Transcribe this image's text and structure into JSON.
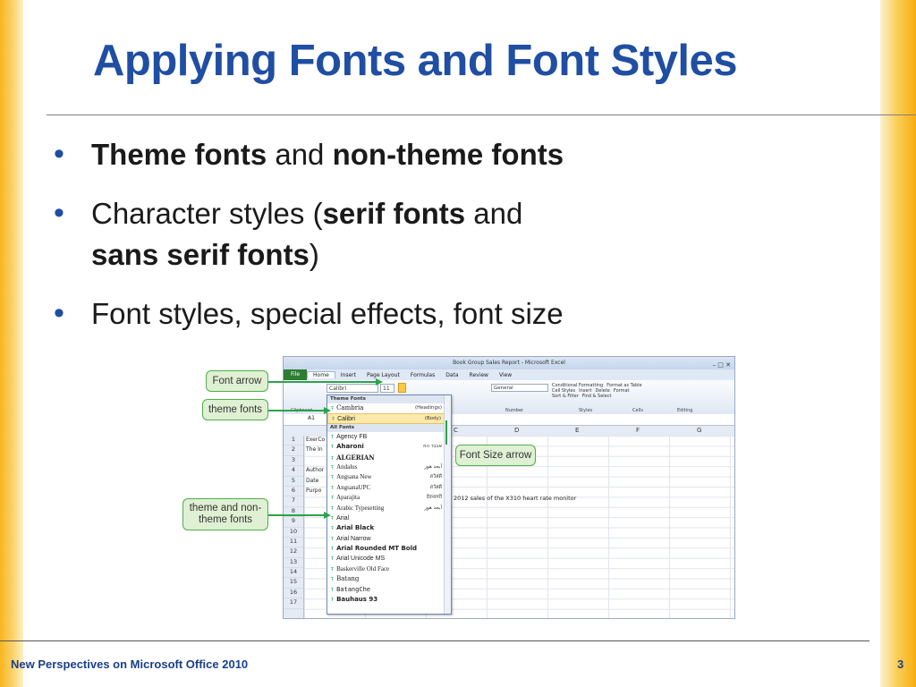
{
  "slide": {
    "title": "Applying Fonts and Font Styles",
    "footer": "New Perspectives on Microsoft Office 2010",
    "page_number": "3"
  },
  "bullets": [
    {
      "parts": [
        {
          "text": "Theme fonts",
          "bold": true
        },
        {
          "text": " and ",
          "bold": false
        },
        {
          "text": "non-theme fonts",
          "bold": true
        }
      ]
    },
    {
      "parts": [
        {
          "text": "Character styles (",
          "bold": false
        },
        {
          "text": "serif fonts",
          "bold": true
        },
        {
          "text": " and ",
          "bold": false
        },
        {
          "text": "sans serif fonts",
          "bold": true
        },
        {
          "text": ")",
          "bold": false
        }
      ]
    },
    {
      "parts": [
        {
          "text": "Font styles, special effects, font size",
          "bold": false
        }
      ]
    }
  ],
  "callouts": {
    "font_arrow": "Font arrow",
    "theme_fonts": "theme fonts",
    "theme_nontheme": "theme and non-theme fonts",
    "font_size_arrow": "Font Size arrow"
  },
  "excel": {
    "window_title": "Book Group Sales Report - Microsoft Excel",
    "tabs": [
      "File",
      "Home",
      "Insert",
      "Page Layout",
      "Formulas",
      "Data",
      "Review",
      "View"
    ],
    "active_tab": "Home",
    "name_box": "A1",
    "font_box": "Calibri",
    "size_box": "11",
    "number_format": "General",
    "ribbon_groups": [
      "Clipboard",
      "Number",
      "Styles",
      "Cells",
      "Editing"
    ],
    "ribbon_buttons": [
      "Conditional Formatting",
      "Format as Table",
      "Cell Styles",
      "Insert",
      "Delete",
      "Format",
      "Sort & Filter",
      "Find & Select"
    ],
    "columns": [
      "C",
      "D",
      "E",
      "F",
      "G"
    ],
    "rows": [
      "1",
      "2",
      "3",
      "4",
      "5",
      "6",
      "7",
      "8",
      "9",
      "10",
      "11",
      "12",
      "13",
      "14",
      "15",
      "16",
      "17"
    ],
    "column_a_cells": [
      {
        "row": 1,
        "text": "ExerCo"
      },
      {
        "row": 2,
        "text": "The In"
      },
      {
        "row": 4,
        "text": "Author"
      },
      {
        "row": 5,
        "text": "Date"
      },
      {
        "row": 6,
        "text": "Purpo"
      }
    ],
    "sales_note": "2012 sales of the X310 heart rate monitor",
    "font_list": {
      "theme_header": "Theme Fonts",
      "all_header": "All Fonts",
      "theme_fonts": [
        {
          "name": "Cambria",
          "tag": "(Headings)",
          "font": "DejaVu Serif"
        },
        {
          "name": "Calibri",
          "tag": "(Body)",
          "font": "Liberation Sans",
          "selected": true
        }
      ],
      "all_fonts": [
        {
          "name": "Agency FB",
          "tag": "",
          "font": "Liberation Sans"
        },
        {
          "name": "Aharoni",
          "tag": "אבגד הוז",
          "font": "DejaVu Sans",
          "bold": true
        },
        {
          "name": "ALGERIAN",
          "tag": "",
          "font": "DejaVu Serif",
          "bold": true
        },
        {
          "name": "Andalus",
          "tag": "أبجد هوز",
          "font": "Liberation Serif"
        },
        {
          "name": "Angsana New",
          "tag": "สวัสดี",
          "font": "Liberation Serif"
        },
        {
          "name": "AngsanaUPC",
          "tag": "สวัสดี",
          "font": "Liberation Serif"
        },
        {
          "name": "Aparajita",
          "tag": "देवनागरी",
          "font": "Liberation Serif"
        },
        {
          "name": "Arabic Typesetting",
          "tag": "أبجد هوز",
          "font": "Liberation Serif"
        },
        {
          "name": "Arial",
          "tag": "",
          "font": "Liberation Sans"
        },
        {
          "name": "Arial Black",
          "tag": "",
          "font": "DejaVu Sans",
          "bold": true
        },
        {
          "name": "Arial Narrow",
          "tag": "",
          "font": "Liberation Sans"
        },
        {
          "name": "Arial Rounded MT Bold",
          "tag": "",
          "font": "DejaVu Sans",
          "bold": true
        },
        {
          "name": "Arial Unicode MS",
          "tag": "",
          "font": "Liberation Sans"
        },
        {
          "name": "Baskerville Old Face",
          "tag": "",
          "font": "Liberation Serif"
        },
        {
          "name": "Batang",
          "tag": "",
          "font": "DejaVu Serif"
        },
        {
          "name": "BatangChe",
          "tag": "",
          "font": "DejaVu Sans Mono"
        },
        {
          "name": "Bauhaus 93",
          "tag": "",
          "font": "DejaVu Sans",
          "bold": true
        }
      ]
    }
  },
  "colors": {
    "title": "#1f4ea3",
    "bullet": "#1f4ea3",
    "callout_fill": "#dff0d3",
    "callout_border": "#4fae4b",
    "arrow": "#2aa34a",
    "side_bar": "#f7b51f"
  }
}
